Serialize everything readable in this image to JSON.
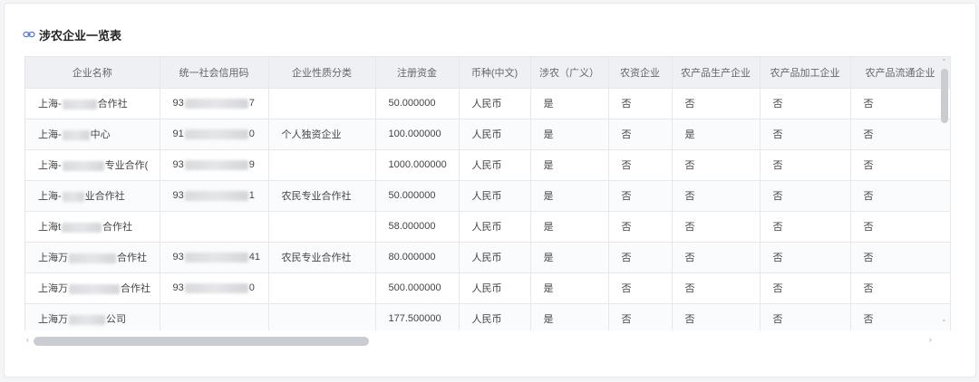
{
  "title": "涉农企业一览表",
  "table": {
    "headers": [
      "企业名称",
      "统一社会信用码",
      "企业性质分类",
      "注册资金",
      "币种(中文)",
      "涉农（广义）",
      "农资企业",
      "农产品生产企业",
      "农产品加工企业",
      "农产品流通企业"
    ],
    "rows": [
      {
        "name_a": "上海-",
        "name_b": "合作社",
        "code_a": "93",
        "code_b": "7",
        "type": "",
        "capital": "50.000000",
        "currency": "人民币",
        "agri": "是",
        "c1": "否",
        "c2": "否",
        "c3": "否",
        "c4": "否"
      },
      {
        "name_a": "上海-",
        "name_b": "中心",
        "code_a": "91",
        "code_b": "0",
        "type": "个人独资企业",
        "capital": "100.000000",
        "currency": "人民币",
        "agri": "是",
        "c1": "否",
        "c2": "是",
        "c3": "否",
        "c4": "否"
      },
      {
        "name_a": "上海-",
        "name_b": "专业合作(",
        "code_a": "93",
        "code_b": "9",
        "type": "",
        "capital": "1000.000000",
        "currency": "人民币",
        "agri": "是",
        "c1": "否",
        "c2": "否",
        "c3": "否",
        "c4": "否"
      },
      {
        "name_a": "上海-",
        "name_b": "业合作社",
        "code_a": "93",
        "code_b": "1",
        "type": "农民专业合作社",
        "capital": "50.000000",
        "currency": "人民币",
        "agri": "是",
        "c1": "否",
        "c2": "否",
        "c3": "否",
        "c4": "否"
      },
      {
        "name_a": "上海t",
        "name_b": "合作社",
        "code_a": "",
        "code_b": "",
        "type": "",
        "capital": "58.000000",
        "currency": "人民币",
        "agri": "是",
        "c1": "否",
        "c2": "否",
        "c3": "否",
        "c4": "否"
      },
      {
        "name_a": "上海万",
        "name_b": "合作社",
        "code_a": "93",
        "code_b": "41",
        "type": "农民专业合作社",
        "capital": "80.000000",
        "currency": "人民币",
        "agri": "是",
        "c1": "否",
        "c2": "否",
        "c3": "否",
        "c4": "否"
      },
      {
        "name_a": "上海万",
        "name_b": "合作社",
        "code_a": "93",
        "code_b": "0",
        "type": "",
        "capital": "500.000000",
        "currency": "人民币",
        "agri": "是",
        "c1": "否",
        "c2": "否",
        "c3": "否",
        "c4": "否"
      },
      {
        "name_a": "上海万",
        "name_b": "公司",
        "code_a": "",
        "code_b": "",
        "type": "",
        "capital": "177.500000",
        "currency": "人民币",
        "agri": "是",
        "c1": "否",
        "c2": "否",
        "c3": "否",
        "c4": "否"
      }
    ]
  },
  "icons": {
    "title_icon": "link-icon",
    "scroll_up": "chevron-up-icon",
    "scroll_down": "chevron-down-icon",
    "scroll_left": "chevron-left-icon",
    "scroll_right": "chevron-right-icon"
  },
  "colors": {
    "header_bg": "#eef0f3",
    "border": "#e6e8ec",
    "accent": "#4a7bd0",
    "scroll_thumb": "#c9ccd0"
  }
}
